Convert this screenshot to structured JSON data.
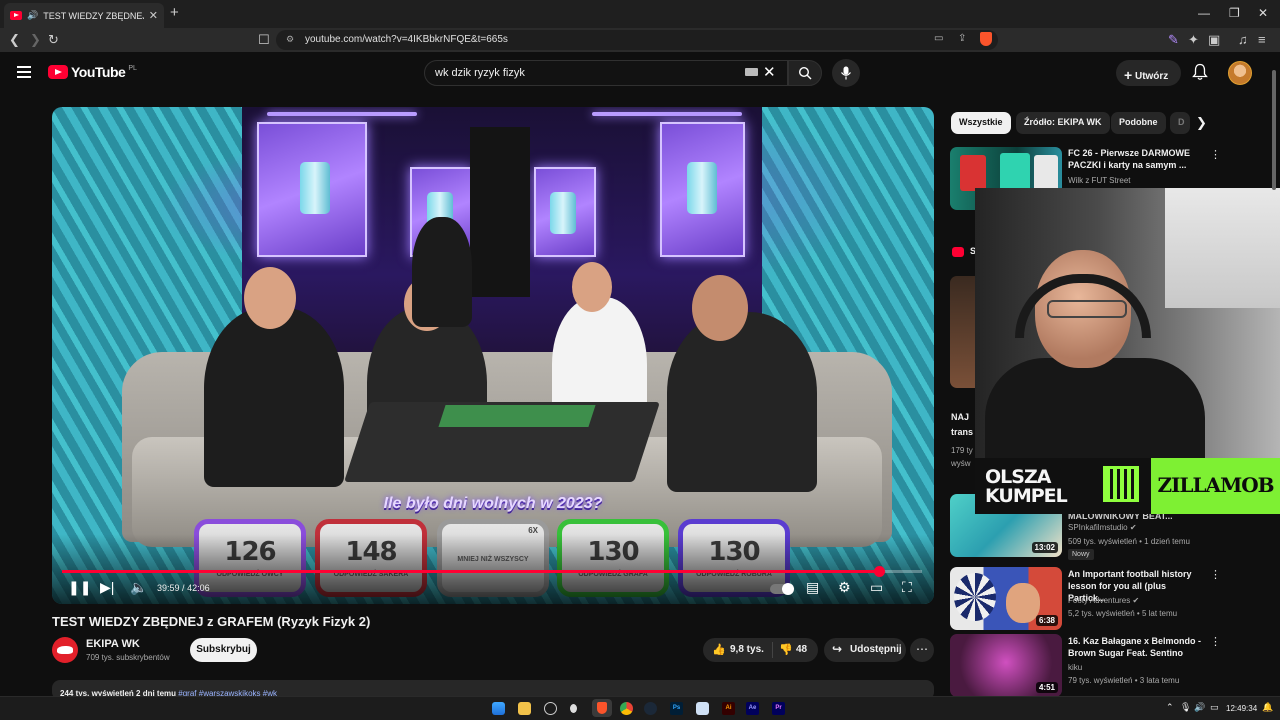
{
  "browser": {
    "tab_title": "TEST WIEDZY ZBĘDNEJ z GRAFEM",
    "url": "youtube.com/watch?v=4IKBbkrNFQE&t=665s"
  },
  "header": {
    "logo_text": "YouTube",
    "region": "PL",
    "search_value": "wk dzik ryzyk fizyk",
    "create_label": "Utwórz"
  },
  "player": {
    "overlay_question": "Ile było dni wolnych w 2023?",
    "answer_cards": [
      {
        "value": "126",
        "label": "ODPOWIEDŹ OWCY",
        "color": "#8a4ddb"
      },
      {
        "value": "148",
        "label": "ODPOWIEDŹ SAKERA",
        "color": "#c0303a"
      },
      {
        "value": "",
        "label": "MNIEJ NIŻ WSZYSCY",
        "tag": "6X",
        "color": "#9a9a9a"
      },
      {
        "value": "130",
        "label": "ODPOWIEDŹ GRAFA",
        "color": "#38c03a"
      },
      {
        "value": "130",
        "label": "ODPOWIEDŹ ROBURA",
        "color": "#5a3cd0"
      }
    ],
    "time_current": "39:59",
    "time_total": "42:06",
    "progress_fraction": 0.95
  },
  "video": {
    "title": "TEST WIEDZY ZBĘDNEJ z GRAFEM (Ryzyk Fizyk 2)",
    "channel_name": "EKIPA WK",
    "subscribers": "709 tys. subskrybentów",
    "subscribe_label": "Subskrybuj",
    "likes": "9,8 tys.",
    "dislikes": "48",
    "share_label": "Udostępnij",
    "description_stats": "244 tys. wyświetleń  2 dni temu",
    "description_tags": "#graf #warszawskikoks #wk"
  },
  "sidebar": {
    "chips": [
      {
        "label": "Wszystkie",
        "active": true
      },
      {
        "label": "Źródło: EKIPA WK",
        "active": false
      },
      {
        "label": "Podobne",
        "active": false
      },
      {
        "label": "D",
        "active": false
      }
    ],
    "recs": [
      {
        "title": "FC 26 - Pierwsze DARMOWE PACZKI i karty na samym ...",
        "channel": "Wilk z FUT Street",
        "meta": ""
      },
      {
        "title": "MALOWNIKOWY BEAT...",
        "channel": "SPInkafilmstudio",
        "meta": "509 tys. wyświetleń • 1 dzień temu",
        "duration": "13:02",
        "badge": "Nowy"
      },
      {
        "title": "An Important football history lesson for you all (plus Partick...",
        "channel": "Footy Adventures",
        "meta": "5,2 tys. wyświetleń • 5 lat temu",
        "duration": "6:38"
      },
      {
        "title": "16. Kaz Bałagane x Belmondo - Brown Sugar Feat. Sentino",
        "channel": "kiku",
        "meta": "79 tys. wyświetleń • 3 lata temu",
        "duration": "4:51"
      }
    ],
    "partial_title_1": "NAJ",
    "partial_title_2": "trans",
    "partial_meta_1": "179 ty",
    "partial_meta_2": "wyśw",
    "partial_section": "S"
  },
  "webcam": {
    "sponsor_left": "OLSZA KUMPEL",
    "sponsor_right": "ZILLAMOB"
  },
  "taskbar": {
    "time": "12:49:34"
  },
  "colors": {
    "accent": "#ff0033",
    "background": "#0f0f0f",
    "chip": "#272727"
  }
}
